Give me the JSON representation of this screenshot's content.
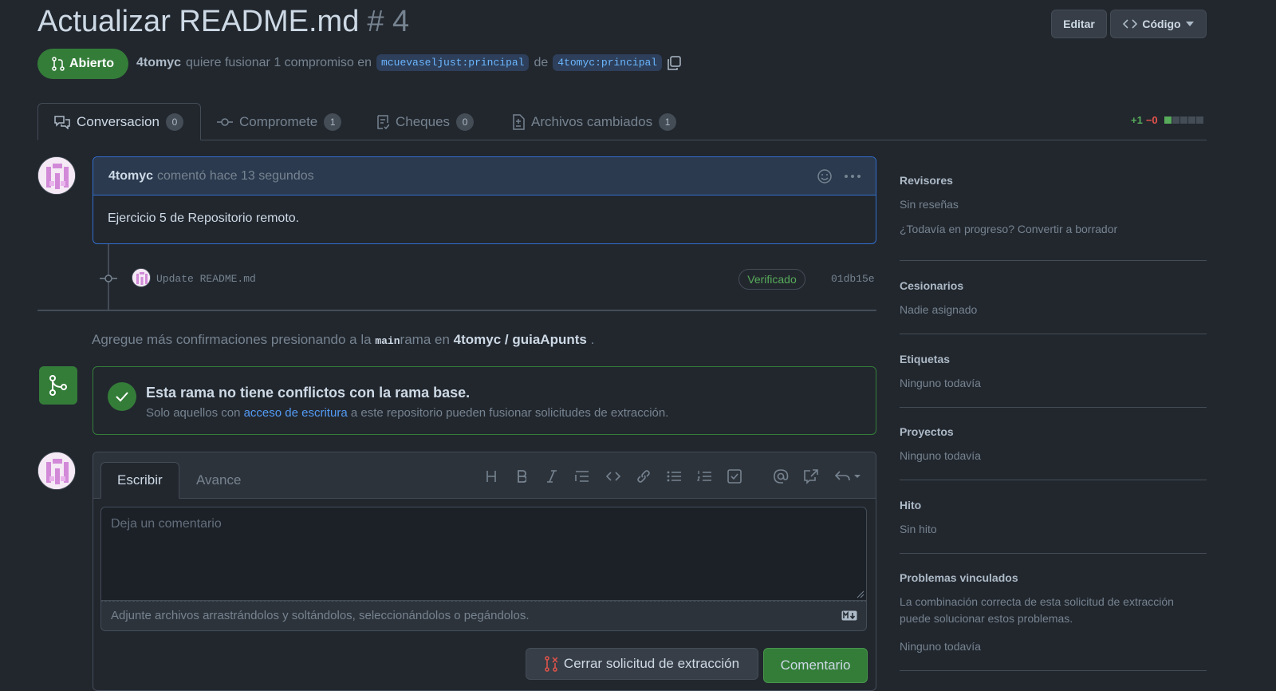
{
  "header": {
    "title": "Actualizar README.md",
    "number": "# 4",
    "edit_label": "Editar",
    "code_label": "Código"
  },
  "status": {
    "state": "Abierto",
    "author": "4tomyc",
    "action_text": "quiere fusionar 1 compromiso en",
    "base_branch": "mcuevaseljust:principal",
    "connector": "de",
    "head_branch": "4tomyc:principal"
  },
  "tabs": [
    {
      "label": "Conversacion",
      "count": "0"
    },
    {
      "label": "ComprometE",
      "count": "1"
    },
    {
      "label": "Cheques",
      "count": "0"
    },
    {
      "label": "Archivos cambiados",
      "count": "1"
    }
  ],
  "diffstat": {
    "add": "+1",
    "del": "−0",
    "colors": {
      "add": "#57ab5a",
      "del": "#e5534b"
    }
  },
  "comment": {
    "author": "4tomyc",
    "meta": "comentó hace 13 segundos",
    "body": "Ejercicio 5 de Repositorio remoto."
  },
  "commit": {
    "message": "Update README.md",
    "badge": "Verificado",
    "sha": "01db15e"
  },
  "hint": {
    "prefix": "Agregue más confirmaciones presionando a la",
    "branch": "main",
    "middle": "rama en",
    "repo": "4tomyc / guiaApunts",
    "suffix": "."
  },
  "merge": {
    "title": "Esta rama no tiene conflictos con la rama base.",
    "text_before": "Solo aquellos con",
    "link": "acceso de escritura",
    "text_after": "a este repositorio pueden fusionar solicitudes de extracción."
  },
  "editor": {
    "tab_write": "Escribir",
    "tab_preview": "Avance",
    "placeholder": "Deja un comentario",
    "attach_text": "Adjunte archivos arrastrándolos y soltándolos, seleccionándolos o pegándolos.",
    "close_label": "Cerrar solicitud de extracción",
    "comment_label": "Comentario"
  },
  "sidebar": {
    "reviewers": {
      "title": "Revisores",
      "value": "Sin reseñas",
      "extra": "¿Todavía en progreso? Convertir a borrador"
    },
    "assignees": {
      "title": "Cesionarios",
      "value": "Nadie asignado"
    },
    "labels": {
      "title": "Etiquetas",
      "value": "Ninguno todavía"
    },
    "projects": {
      "title": "Proyectos",
      "value": "Ninguno todavía"
    },
    "milestone": {
      "title": "Hito",
      "value": "Sin hito"
    },
    "linked": {
      "title": "Problemas vinculados",
      "desc": "La combinación correcta de esta solicitud de extracción puede solucionar estos problemas.",
      "value": "Ninguno todavía"
    }
  }
}
